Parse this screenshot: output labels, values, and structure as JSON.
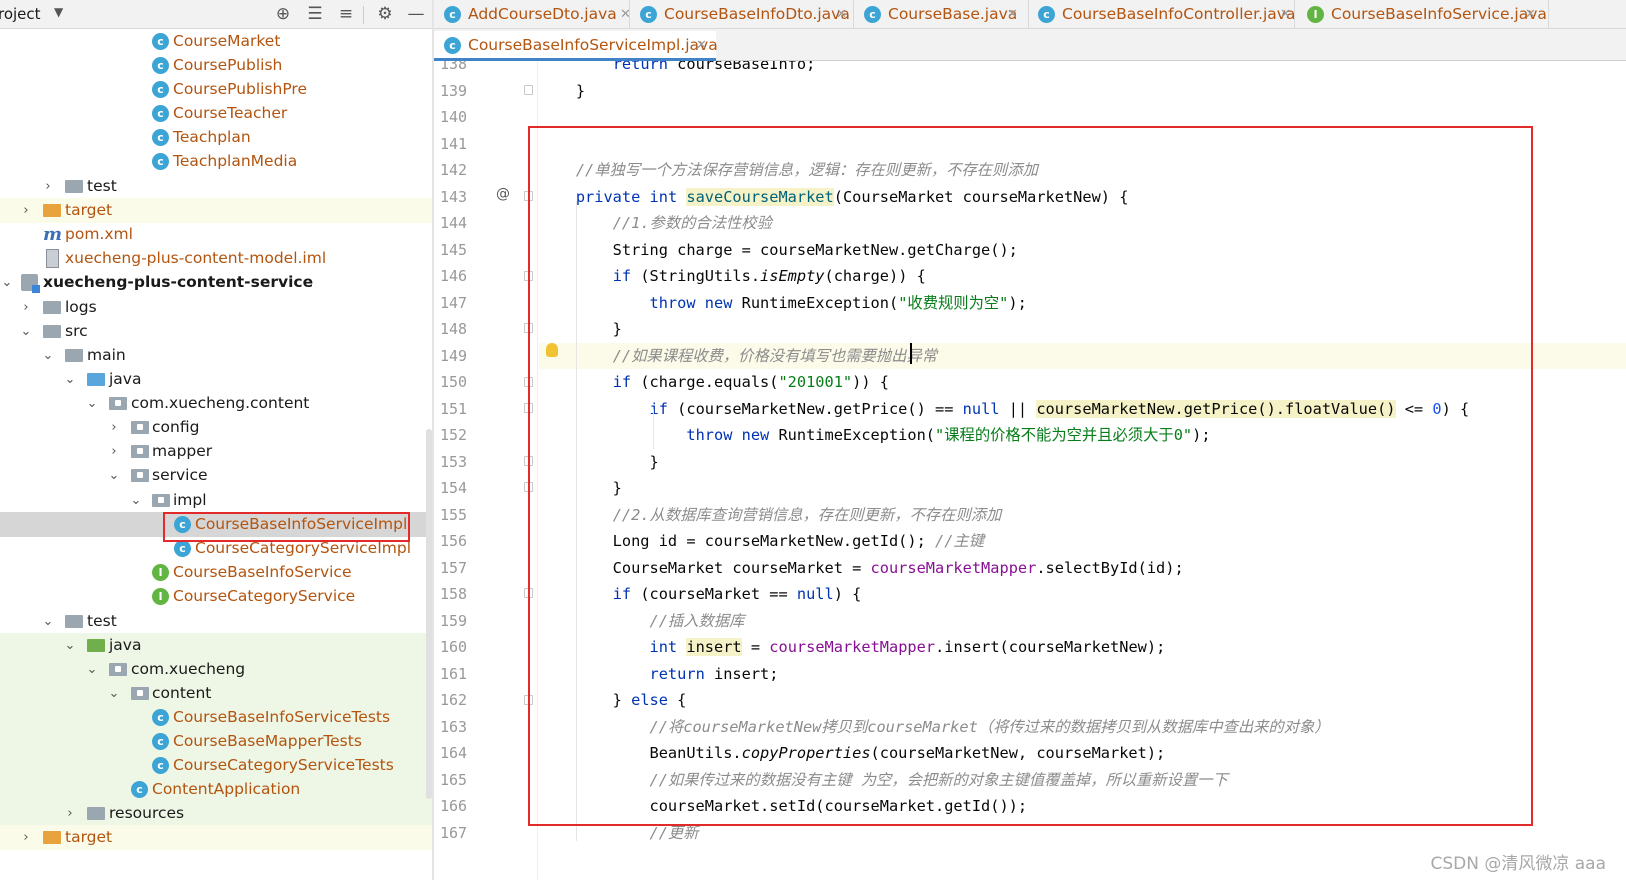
{
  "project_panel": {
    "title": "roject",
    "tree": [
      {
        "label": "CourseMarket",
        "icon": "class"
      },
      {
        "label": "CoursePublish",
        "icon": "class"
      },
      {
        "label": "CoursePublishPre",
        "icon": "class"
      },
      {
        "label": "CourseTeacher",
        "icon": "class"
      },
      {
        "label": "Teachplan",
        "icon": "class"
      },
      {
        "label": "TeachplanMedia",
        "icon": "class"
      },
      {
        "label": "test",
        "icon": "folder"
      },
      {
        "label": "target",
        "icon": "folder-excluded"
      },
      {
        "label": "pom.xml",
        "icon": "maven"
      },
      {
        "label": "xuecheng-plus-content-model.iml",
        "icon": "iml-file"
      },
      {
        "label": "xuecheng-plus-content-service",
        "icon": "module"
      },
      {
        "label": "logs",
        "icon": "folder"
      },
      {
        "label": "src",
        "icon": "folder"
      },
      {
        "label": "main",
        "icon": "folder"
      },
      {
        "label": "java",
        "icon": "source-folder"
      },
      {
        "label": "com.xuecheng.content",
        "icon": "package"
      },
      {
        "label": "config",
        "icon": "package"
      },
      {
        "label": "mapper",
        "icon": "package"
      },
      {
        "label": "service",
        "icon": "package"
      },
      {
        "label": "impl",
        "icon": "package"
      },
      {
        "label": "CourseBaseInfoServiceImpl",
        "icon": "class"
      },
      {
        "label": "CourseCategoryServiceImpl",
        "icon": "class"
      },
      {
        "label": "CourseBaseInfoService",
        "icon": "interface"
      },
      {
        "label": "CourseCategoryService",
        "icon": "interface"
      },
      {
        "label": "test",
        "icon": "folder"
      },
      {
        "label": "java",
        "icon": "test-folder"
      },
      {
        "label": "com.xuecheng",
        "icon": "package"
      },
      {
        "label": "content",
        "icon": "package"
      },
      {
        "label": "CourseBaseInfoServiceTests",
        "icon": "test-class"
      },
      {
        "label": "CourseBaseMapperTests",
        "icon": "test-class"
      },
      {
        "label": "CourseCategoryServiceTests",
        "icon": "test-class"
      },
      {
        "label": "ContentApplication",
        "icon": "spring-class"
      },
      {
        "label": "resources",
        "icon": "resources-folder"
      },
      {
        "label": "target",
        "icon": "folder-excluded"
      }
    ]
  },
  "tabs_row1": [
    {
      "label": "AddCourseDto.java",
      "icon": "class"
    },
    {
      "label": "CourseBaseInfoDto.java",
      "icon": "class"
    },
    {
      "label": "CourseBase.java",
      "icon": "class"
    },
    {
      "label": "CourseBaseInfoController.java",
      "icon": "class"
    },
    {
      "label": "CourseBaseInfoService.java",
      "icon": "interface"
    }
  ],
  "tabs_row2": [
    {
      "label": "CourseBaseInfoServiceImpl.java",
      "icon": "class",
      "active": true
    }
  ],
  "editor": {
    "line_numbers": [
      "138",
      "139",
      "140",
      "141",
      "142",
      "143",
      "144",
      "145",
      "146",
      "147",
      "148",
      "149",
      "150",
      "151",
      "152",
      "153",
      "154",
      "155",
      "156",
      "157",
      "158",
      "159",
      "160",
      "161",
      "162",
      "163",
      "164",
      "165",
      "166",
      "167"
    ],
    "current_line": "149"
  },
  "watermark": "CSDN @清风微凉 aaa",
  "colors": {
    "highlight_box": "#e32a2a",
    "keyword": "#0033b3",
    "comment": "#8c8c8c",
    "string": "#067d17",
    "field": "#871094"
  }
}
